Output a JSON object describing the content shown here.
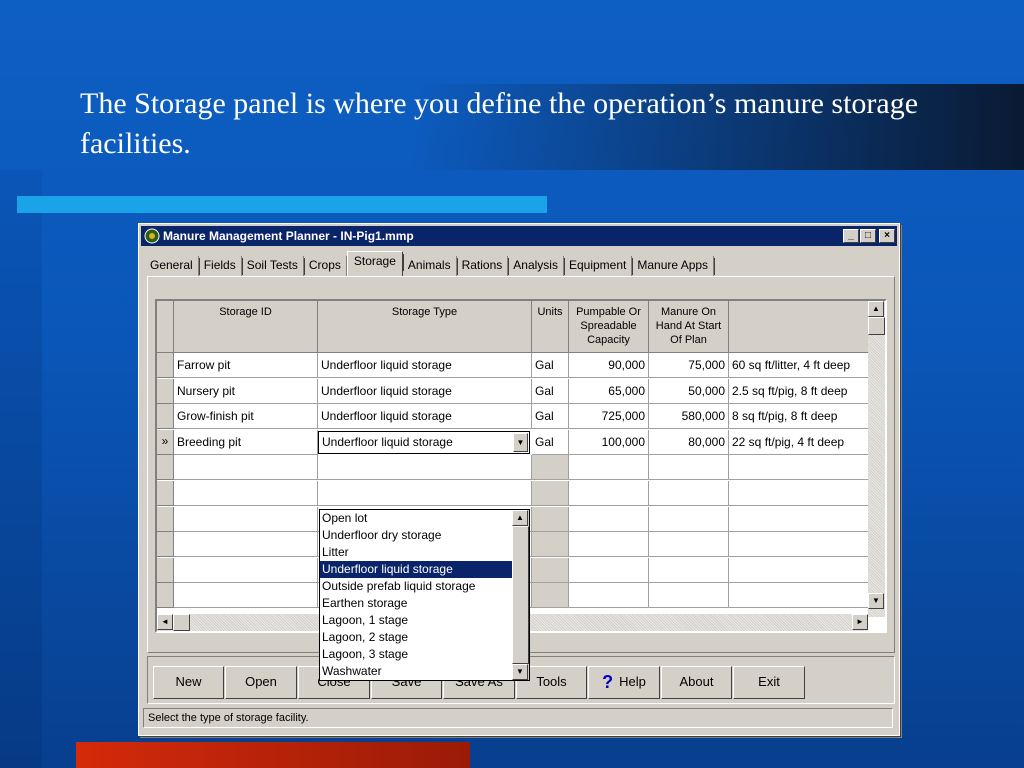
{
  "slide": {
    "title_highlight": "The Storage",
    "title_rest": " panel is where you define the operation’s manure storage facilities."
  },
  "window": {
    "title": "Manure Management Planner - IN-Pig1.mmp",
    "buttons": {
      "minimize": "_",
      "maximize": "□",
      "close": "×"
    }
  },
  "tabs": [
    "General",
    "Fields",
    "Soil Tests",
    "Crops",
    "Storage",
    "Animals",
    "Rations",
    "Analysis",
    "Equipment",
    "Manure Apps"
  ],
  "active_tab": "Storage",
  "grid": {
    "headers": [
      "Storage ID",
      "Storage Type",
      "Units",
      "Pumpable Or Spreadable Capacity",
      "Manure On Hand At Start Of Plan",
      ""
    ],
    "rows": [
      {
        "id": "Farrow pit",
        "type": "Underfloor liquid storage",
        "units": "Gal",
        "capacity": "90,000",
        "on_hand": "75,000",
        "desc": "60 sq ft/litter, 4 ft deep"
      },
      {
        "id": "Nursery pit",
        "type": "Underfloor liquid storage",
        "units": "Gal",
        "capacity": "65,000",
        "on_hand": "50,000",
        "desc": "2.5 sq ft/pig, 8 ft deep"
      },
      {
        "id": "Grow-finish pit",
        "type": "Underfloor liquid storage",
        "units": "Gal",
        "capacity": "725,000",
        "on_hand": "580,000",
        "desc": "8 sq ft/pig, 8 ft deep"
      },
      {
        "id": "Breeding pit",
        "type": "Underfloor liquid storage",
        "units": "Gal",
        "capacity": "100,000",
        "on_hand": "80,000",
        "desc": "22 sq ft/pig, 4 ft deep"
      }
    ],
    "current_row_marker": "»"
  },
  "dropdown": {
    "options": [
      "Open lot",
      "Underfloor dry storage",
      "Litter",
      "Underfloor liquid storage",
      "Outside prefab liquid storage",
      "Earthen storage",
      "Lagoon, 1 stage",
      "Lagoon, 2 stage",
      "Lagoon, 3 stage",
      "Washwater"
    ],
    "selected": "Underfloor liquid storage"
  },
  "toolbar": {
    "new": "New",
    "open": "Open",
    "close": "Close",
    "save": "Save",
    "save_as": "Save As",
    "tools": "Tools",
    "help": "Help",
    "about": "About",
    "exit": "Exit"
  },
  "status": "Select the type of storage facility."
}
